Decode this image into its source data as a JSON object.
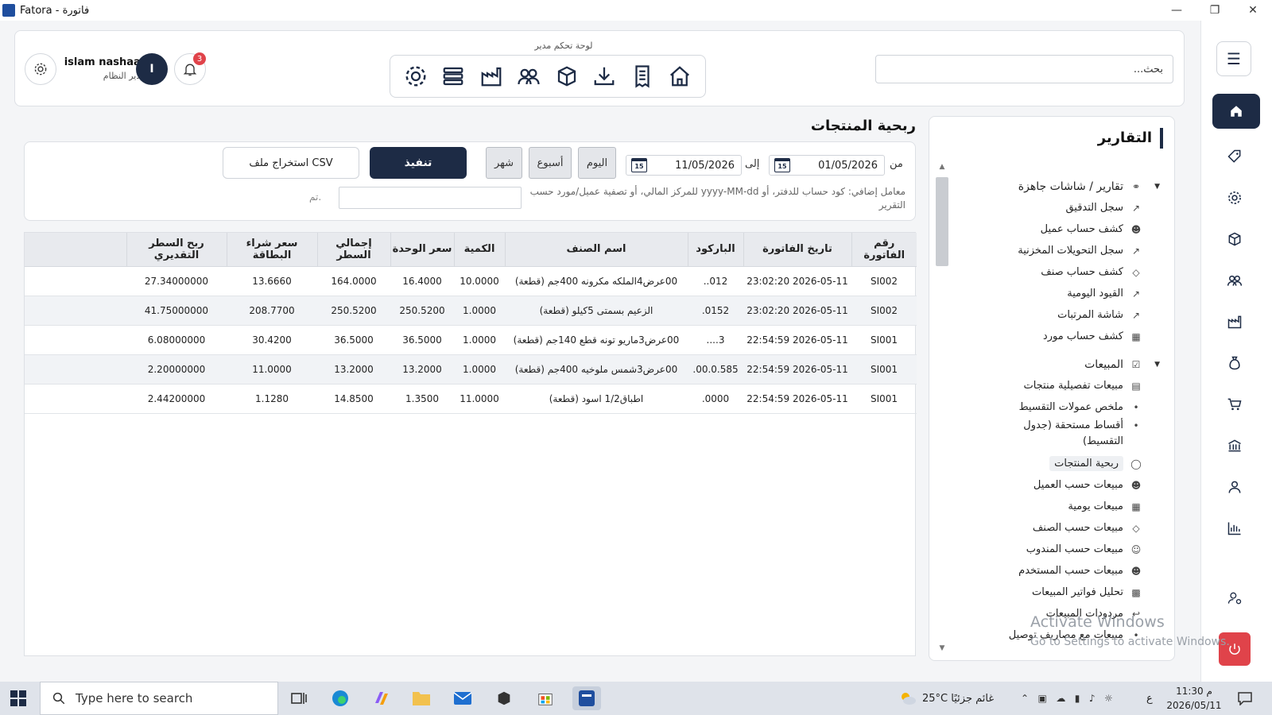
{
  "window": {
    "title": "Fatora - فاتورة"
  },
  "header": {
    "search_placeholder": "بحث...",
    "admin_panel_title": "لوحة تحكم مدير",
    "user_name": "islam nashaat",
    "user_role": "مدير النظام",
    "avatar_letter": "I",
    "notifications_count": "3"
  },
  "sidebar": {
    "title": "التقارير",
    "sections": [
      {
        "label": "تقارير / شاشات جاهزة",
        "items": [
          "سجل التدقيق",
          "كشف حساب عميل",
          "سجل التحويلات المخزنية",
          "كشف حساب صنف",
          "القيود اليومية",
          "شاشة المرتبات",
          "كشف حساب مورد"
        ]
      },
      {
        "label": "المبيعات",
        "items": [
          "مبيعات تفصيلية منتجات",
          "ملخص عمولات التقسيط",
          "أقساط مستحقة (جدول التقسيط)",
          "ربحية المنتجات",
          "مبيعات حسب العميل",
          "مبيعات يومية",
          "مبيعات حسب الصنف",
          "مبيعات حسب المندوب",
          "مبيعات حسب المستخدم",
          "تحليل فواتير المبيعات",
          "مردودات المبيعات",
          "مبيعات مع مصاريف توصيل"
        ]
      }
    ]
  },
  "main": {
    "page_title": "ربحية المنتجات",
    "filter": {
      "from_label": "من",
      "from_date": "01/05/2026",
      "to_label": "إلى",
      "to_date": "11/05/2026",
      "calendar_day": "15",
      "today": "اليوم",
      "week": "أسبوع",
      "month": "شهر",
      "execute": "تنفيذ",
      "export_csv": "استخراج ملف CSV",
      "param_label": "معامل إضافي: كود حساب للدفتر، أو yyyy-MM-dd للمركز المالي، أو تصفية عميل/مورد حسب التقرير",
      "status": "تم."
    },
    "table": {
      "columns": [
        "رقم الفاتورة",
        "تاريخ الفاتورة",
        "الباركود",
        "اسم الصنف",
        "الكمية",
        "سعر الوحدة",
        "إجمالي السطر",
        "سعر شراء البطاقة",
        "ربح السطر التقديري"
      ],
      "rows": [
        [
          "SI002",
          "2026-05-11 23:02:20",
          "012..",
          "00عرض4الملكه مكرونه 400جم (قطعة)",
          "10.0000",
          "16.4000",
          "164.0000",
          "13.6660",
          "27.34000000"
        ],
        [
          "SI002",
          "2026-05-11 23:02:20",
          "0152.",
          "الزعيم بسمتى 5كيلو (قطعة)",
          "1.0000",
          "250.5200",
          "250.5200",
          "208.7700",
          "41.75000000"
        ],
        [
          "SI001",
          "2026-05-11 22:54:59",
          "3....",
          "00عرض3ماريو تونه قطع 140جم (قطعة)",
          "1.0000",
          "36.5000",
          "36.5000",
          "30.4200",
          "6.08000000"
        ],
        [
          "SI001",
          "2026-05-11 22:54:59",
          "00.0.585.",
          "00عرض3شمس ملوخيه 400جم (قطعة)",
          "1.0000",
          "13.2000",
          "13.2000",
          "11.0000",
          "2.20000000"
        ],
        [
          "SI001",
          "2026-05-11 22:54:59",
          "0000.",
          "اطباق1/2 اسود (قطعة)",
          "11.0000",
          "1.3500",
          "14.8500",
          "1.1280",
          "2.44200000"
        ]
      ]
    }
  },
  "watermark": {
    "line1": "Activate Windows",
    "line2": "Go to Settings to activate Windows."
  },
  "taskbar": {
    "search_placeholder": "Type here to search",
    "weather": "25°C  غائم جزئيًا",
    "lang": "ع",
    "time": "11:30 م",
    "date": "2026/05/11"
  }
}
